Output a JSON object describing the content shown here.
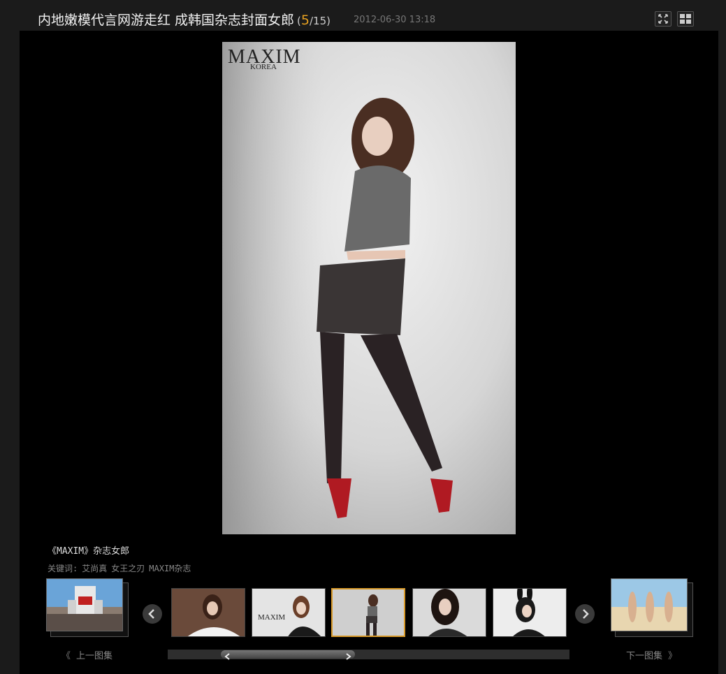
{
  "header": {
    "title": "内地嫩模代言网游走红 成韩国杂志封面女郎",
    "counter_open": "(",
    "current": "5",
    "total": "/15)",
    "date": "2012-06-30 13:18"
  },
  "photo": {
    "magazine_logo": "MAXIM",
    "magazine_sub": "KOREA"
  },
  "caption": "《MAXIM》杂志女郎",
  "keywords": {
    "label": "关键词:",
    "tags": [
      "艾尚真",
      "女王之刃",
      "MAXIM杂志"
    ]
  },
  "nav": {
    "prev_album": "上一图集",
    "next_album": "下一图集",
    "prev_arrows": "《",
    "next_arrows": "》"
  },
  "thumbnails": [
    {
      "label": "thumb-1"
    },
    {
      "label": "thumb-2",
      "logo": "MAXIM"
    },
    {
      "label": "thumb-3"
    },
    {
      "label": "thumb-4"
    },
    {
      "label": "thumb-5"
    }
  ],
  "active_thumbnail_index": 2,
  "colors": {
    "accent": "#d89a2a",
    "background": "#000000",
    "frame": "#1b1b1b"
  }
}
